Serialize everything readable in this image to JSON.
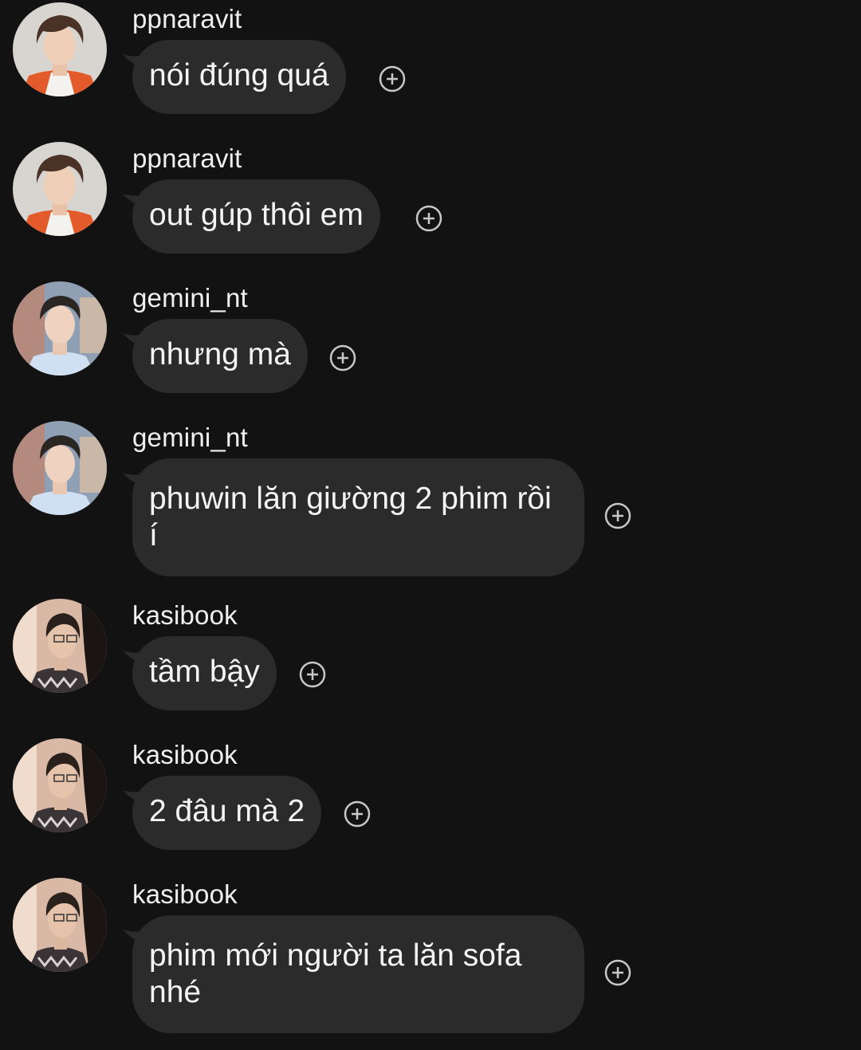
{
  "messages": [
    {
      "username": "ppnaravit",
      "text": "nói đúng quá",
      "avatar": "avatar-ppnaravit",
      "add_reaction_icon": "plus-circle-icon"
    },
    {
      "username": "ppnaravit",
      "text": "out gúp thôi em",
      "avatar": "avatar-ppnaravit",
      "add_reaction_icon": "plus-circle-icon"
    },
    {
      "username": "gemini_nt",
      "text": "nhưng mà",
      "avatar": "avatar-gemini_nt",
      "add_reaction_icon": "plus-circle-icon"
    },
    {
      "username": "gemini_nt",
      "text": "phuwin lăn giường 2 phim rồi í",
      "avatar": "avatar-gemini_nt",
      "add_reaction_icon": "plus-circle-icon"
    },
    {
      "username": "kasibook",
      "text": "tầm bậy",
      "avatar": "avatar-kasibook",
      "add_reaction_icon": "plus-circle-icon"
    },
    {
      "username": "kasibook",
      "text": "2 đâu mà 2",
      "avatar": "avatar-kasibook",
      "add_reaction_icon": "plus-circle-icon"
    },
    {
      "username": "kasibook",
      "text": "phim mới người ta lăn sofa nhé",
      "avatar": "avatar-kasibook",
      "add_reaction_icon": "plus-circle-icon"
    }
  ],
  "colors": {
    "background": "#121212",
    "bubble": "#2b2b2b",
    "text": "#f4f4f4",
    "icon": "#c8c8c8"
  }
}
